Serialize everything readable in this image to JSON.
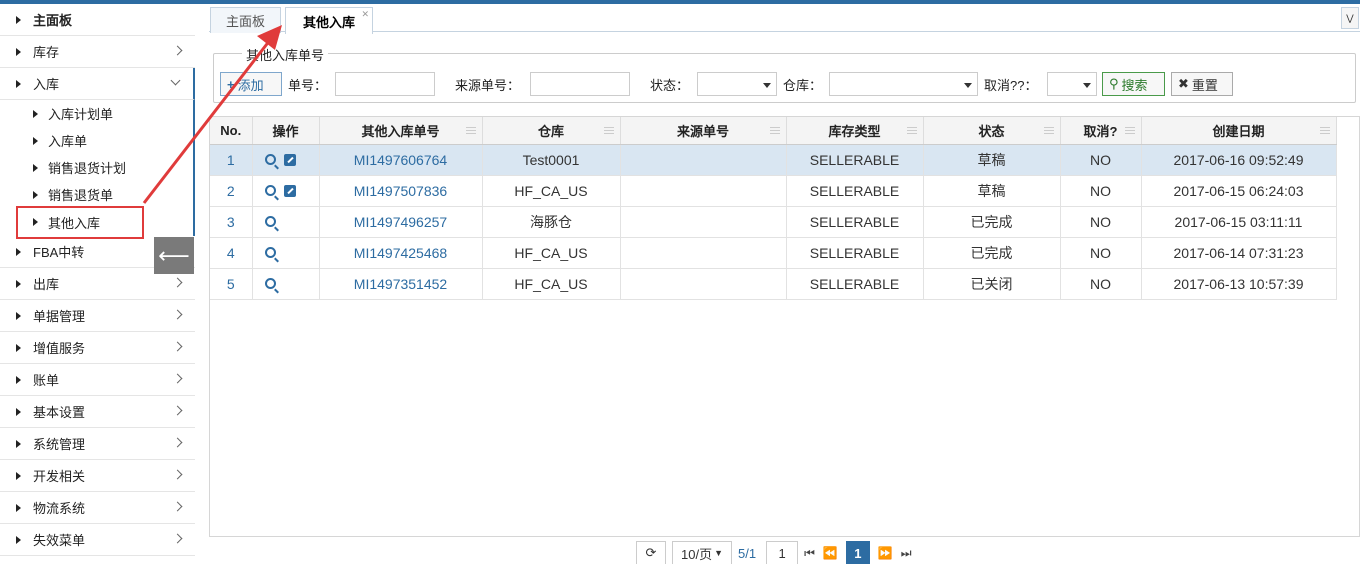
{
  "sidebar": {
    "items": [
      {
        "label": "主面板"
      },
      {
        "label": "库存"
      },
      {
        "label": "入库"
      },
      {
        "label": "FBA中转"
      },
      {
        "label": "出库"
      },
      {
        "label": "单据管理"
      },
      {
        "label": "增值服务"
      },
      {
        "label": "账单"
      },
      {
        "label": "基本设置"
      },
      {
        "label": "系统管理"
      },
      {
        "label": "开发相关"
      },
      {
        "label": "物流系统"
      },
      {
        "label": "失效菜单"
      }
    ],
    "subitems": [
      {
        "label": "入库计划单"
      },
      {
        "label": "入库单"
      },
      {
        "label": "销售退货计划"
      },
      {
        "label": "销售退货单"
      },
      {
        "label": "其他入库"
      }
    ]
  },
  "tabs": [
    {
      "label": "主面板"
    },
    {
      "label": "其他入库"
    }
  ],
  "filter": {
    "legend": "其他入库单号",
    "add_label": "添加",
    "order_no_label": "单号：",
    "source_no_label": "来源单号：",
    "status_label": "状态：",
    "warehouse_label": "仓库：",
    "cancel_label": "取消??：",
    "search_label": "搜索",
    "reset_label": "重置"
  },
  "table": {
    "headers": [
      "No.",
      "操作",
      "其他入库单号",
      "仓库",
      "来源单号",
      "库存类型",
      "状态",
      "取消?",
      "创建日期"
    ],
    "rows": [
      {
        "no": "1",
        "order": "MI1497606764",
        "warehouse": "Test0001",
        "source": "",
        "type": "SELLERABLE",
        "status": "草稿",
        "cancel": "NO",
        "date": "2017-06-16 09:52:49",
        "editable": true
      },
      {
        "no": "2",
        "order": "MI1497507836",
        "warehouse": "HF_CA_US",
        "source": "",
        "type": "SELLERABLE",
        "status": "草稿",
        "cancel": "NO",
        "date": "2017-06-15 06:24:03",
        "editable": true
      },
      {
        "no": "3",
        "order": "MI1497496257",
        "warehouse": "海豚仓",
        "source": "",
        "type": "SELLERABLE",
        "status": "已完成",
        "cancel": "NO",
        "date": "2017-06-15 03:11:11",
        "editable": false
      },
      {
        "no": "4",
        "order": "MI1497425468",
        "warehouse": "HF_CA_US",
        "source": "",
        "type": "SELLERABLE",
        "status": "已完成",
        "cancel": "NO",
        "date": "2017-06-14 07:31:23",
        "editable": false
      },
      {
        "no": "5",
        "order": "MI1497351452",
        "warehouse": "HF_CA_US",
        "source": "",
        "type": "SELLERABLE",
        "status": "已关闭",
        "cancel": "NO",
        "date": "2017-06-13 10:57:39",
        "editable": false
      }
    ]
  },
  "pager": {
    "page_size": "10/页",
    "page_info": "5/1",
    "page_input": "1",
    "current": "1"
  },
  "colors": {
    "accent": "#2d6ca2",
    "annotation": "#e03b3b"
  }
}
